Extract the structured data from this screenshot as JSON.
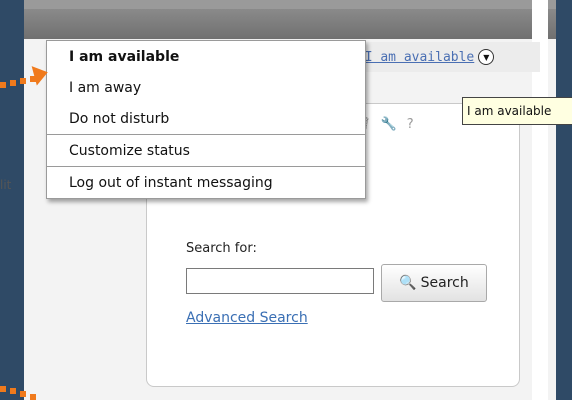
{
  "header": {
    "status_label": "I am available",
    "status_icon": "person-icon",
    "status_menu_icon": "chevron-down-icon"
  },
  "status_menu": {
    "items": [
      {
        "label": "I am available",
        "selected": true
      },
      {
        "label": "I am away"
      },
      {
        "label": "Do not disturb"
      },
      {
        "label": "Customize status"
      },
      {
        "label": "Log out of instant messaging"
      }
    ]
  },
  "tooltip": {
    "text": "I am available"
  },
  "portlet": {
    "tools": [
      "trash-icon",
      "wrench-icon",
      "help-icon"
    ],
    "edit_fragment": "lit"
  },
  "search": {
    "label": "Search for:",
    "input_value": "",
    "button_label": "Search",
    "button_icon": "magnifier-icon",
    "advanced_link": "Advanced Search"
  },
  "colors": {
    "background": "#2f4a66",
    "annotation_arrow": "#f07a1c",
    "link": "#3a6fb4",
    "status_icon": "#2c8a2c"
  }
}
